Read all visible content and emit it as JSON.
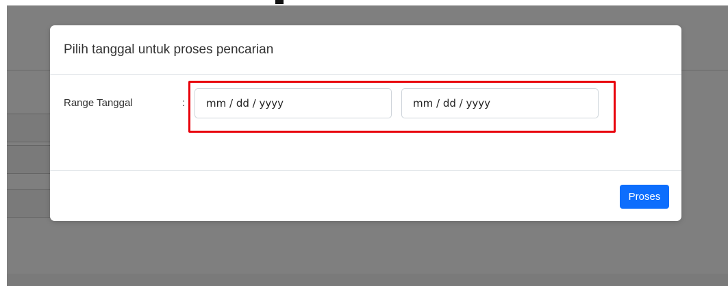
{
  "modal": {
    "title": "Pilih tanggal untuk proses pencarian",
    "field_label": "Range Tanggal",
    "separator": ":",
    "date_start_placeholder": "mm / dd / yyyy",
    "date_end_placeholder": "mm / dd / yyyy",
    "submit_label": "Proses"
  },
  "colors": {
    "primary": "#0d6efd",
    "highlight": "#e8000b",
    "backdrop": "rgba(0,0,0,0.5)"
  }
}
